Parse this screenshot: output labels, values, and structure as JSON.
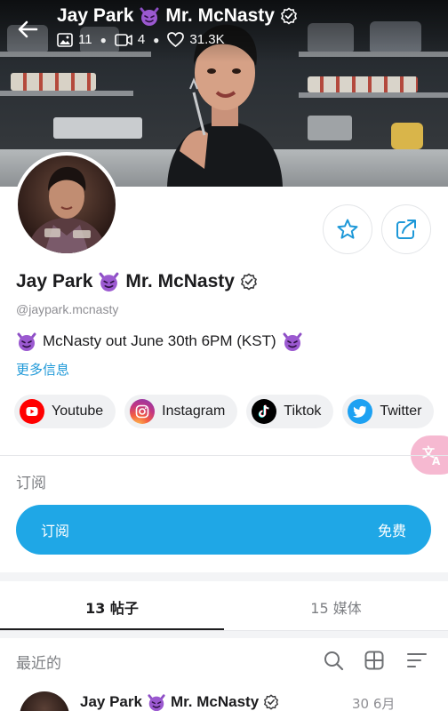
{
  "header": {
    "title": "Jay Park 😈 Mr. McNasty",
    "name_text": "Jay Park",
    "name_suffix": "Mr. McNasty",
    "stats": {
      "photos": "11",
      "videos": "4",
      "likes": "31.3K"
    }
  },
  "profile": {
    "name_text": "Jay Park",
    "name_suffix": "Mr. McNasty",
    "handle": "@jaypark.mcnasty",
    "bio": "McNasty out June 30th 6PM (KST)",
    "more_info": "更多信息"
  },
  "links": [
    {
      "label": "Youtube",
      "icon": "youtube-icon",
      "color": "#ff0000"
    },
    {
      "label": "Instagram",
      "icon": "instagram-icon",
      "color": "#e1306c"
    },
    {
      "label": "Tiktok",
      "icon": "tiktok-icon",
      "color": "#000000"
    },
    {
      "label": "Twitter",
      "icon": "twitter-icon",
      "color": "#1da1f2"
    }
  ],
  "subscription": {
    "heading": "订阅",
    "button_label": "订阅",
    "price_label": "免费"
  },
  "tabs": [
    {
      "label": "13 帖子",
      "active": true
    },
    {
      "label": "15 媒体",
      "active": false
    }
  ],
  "feed": {
    "recent_label": "最近的",
    "post": {
      "author_name": "Jay Park",
      "author_suffix": "Mr. McNasty",
      "date": "30 6月"
    }
  },
  "colors": {
    "accent": "#1fa7e6",
    "link": "#1d98d8",
    "translate_fab": "#f6b9d1",
    "verified": "#3a3a3c"
  }
}
